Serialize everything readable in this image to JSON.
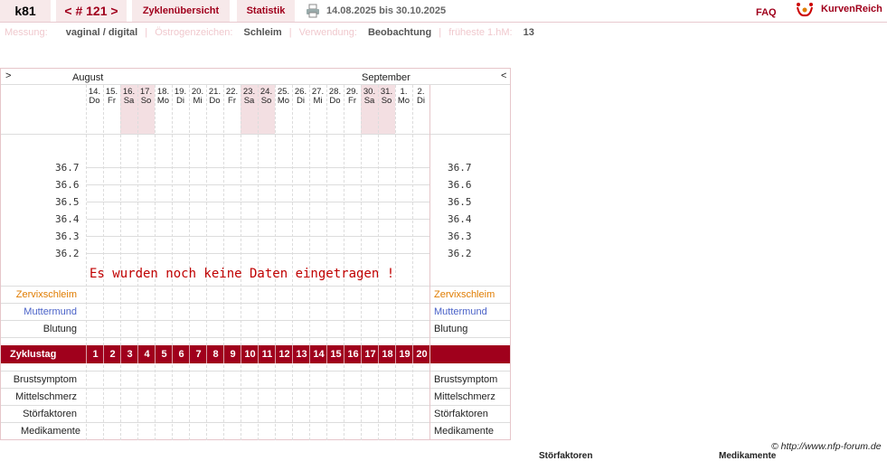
{
  "header": {
    "user": "k81",
    "cycle": "< # 121 >",
    "tab_overview": "Zyklenübersicht",
    "tab_stats": "Statistik",
    "date_range": "14.08.2025 bis 30.10.2025",
    "faq": "FAQ",
    "brand": "KurvenReich"
  },
  "meta": {
    "measurement_label": "Messung:",
    "measurement_value": "vaginal / digital",
    "estrogen_label": "Östrogenzeichen:",
    "estrogen_value": "Schleim",
    "usage_label": "Verwendung:",
    "usage_value": "Beobachtung",
    "earliest_label": "früheste 1.hM:",
    "earliest_value": "13"
  },
  "chart": {
    "nav_prev": ">",
    "nav_next": "<",
    "month_left": "August",
    "month_right": "September",
    "days": [
      {
        "d": "14.",
        "w": "Do",
        "we": false
      },
      {
        "d": "15.",
        "w": "Fr",
        "we": false
      },
      {
        "d": "16.",
        "w": "Sa",
        "we": true
      },
      {
        "d": "17.",
        "w": "So",
        "we": true
      },
      {
        "d": "18.",
        "w": "Mo",
        "we": false
      },
      {
        "d": "19.",
        "w": "Di",
        "we": false
      },
      {
        "d": "20.",
        "w": "Mi",
        "we": false
      },
      {
        "d": "21.",
        "w": "Do",
        "we": false
      },
      {
        "d": "22.",
        "w": "Fr",
        "we": false
      },
      {
        "d": "23.",
        "w": "Sa",
        "we": true
      },
      {
        "d": "24.",
        "w": "So",
        "we": true
      },
      {
        "d": "25.",
        "w": "Mo",
        "we": false
      },
      {
        "d": "26.",
        "w": "Di",
        "we": false
      },
      {
        "d": "27.",
        "w": "Mi",
        "we": false
      },
      {
        "d": "28.",
        "w": "Do",
        "we": false
      },
      {
        "d": "29.",
        "w": "Fr",
        "we": false
      },
      {
        "d": "30.",
        "w": "Sa",
        "we": true
      },
      {
        "d": "31.",
        "w": "So",
        "we": true
      },
      {
        "d": "1.",
        "w": "Mo",
        "we": false
      },
      {
        "d": "2.",
        "w": "Di",
        "we": false
      }
    ],
    "temps": [
      "36.7",
      "36.6",
      "36.5",
      "36.4",
      "36.3",
      "36.2"
    ],
    "no_data": "Es wurden noch keine Daten eingetragen !",
    "row_cervix": "Zervixschleim",
    "row_os": "Muttermund",
    "row_bleeding": "Blutung",
    "cycle_day_label": "Zyklustag",
    "cycle_days": [
      "1",
      "2",
      "3",
      "4",
      "5",
      "6",
      "7",
      "8",
      "9",
      "10",
      "11",
      "12",
      "13",
      "14",
      "15",
      "16",
      "17",
      "18",
      "19",
      "20"
    ],
    "row_breast": "Brustsymptom",
    "row_mittel": "Mittelschmerz",
    "row_stoer": "Störfaktoren",
    "row_medi": "Medikamente",
    "colors": {
      "accent": "#a0001c",
      "cervix": "#e07c00",
      "os": "#4a62c8"
    }
  },
  "footer": {
    "copyright": "© http://www.nfp-forum.de",
    "cut_left": "Störfaktoren",
    "cut_right": "Medikamente"
  }
}
